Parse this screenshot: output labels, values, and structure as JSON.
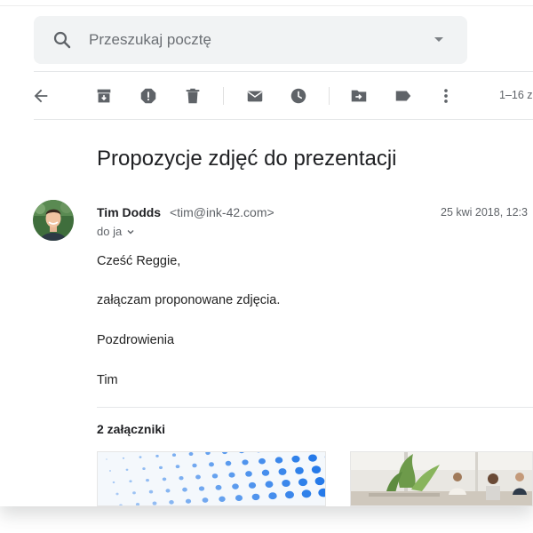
{
  "search": {
    "placeholder": "Przeszukaj pocztę"
  },
  "toolbar": {
    "pager": "1–16 z",
    "icons": [
      "back-arrow-icon",
      "archive-icon",
      "report-spam-icon",
      "delete-icon",
      "mark-unread-icon",
      "snooze-icon",
      "move-to-icon",
      "label-icon",
      "more-vert-icon"
    ]
  },
  "message": {
    "subject": "Propozycje zdjęć do prezentacji",
    "sender_name": "Tim Dodds",
    "sender_email": "<tim@ink-42.com>",
    "date": "25 kwi 2018, 12:3",
    "to": "do ja",
    "body": [
      "Cześć Reggie,",
      "załączam proponowane zdjęcia.",
      "Pozdrowienia",
      "Tim"
    ]
  },
  "attachments": {
    "title": "2 załączniki"
  },
  "colors": {
    "icon": "#5f6368",
    "search_bg": "#f1f3f4",
    "dot_blue": "#1a73e8"
  }
}
